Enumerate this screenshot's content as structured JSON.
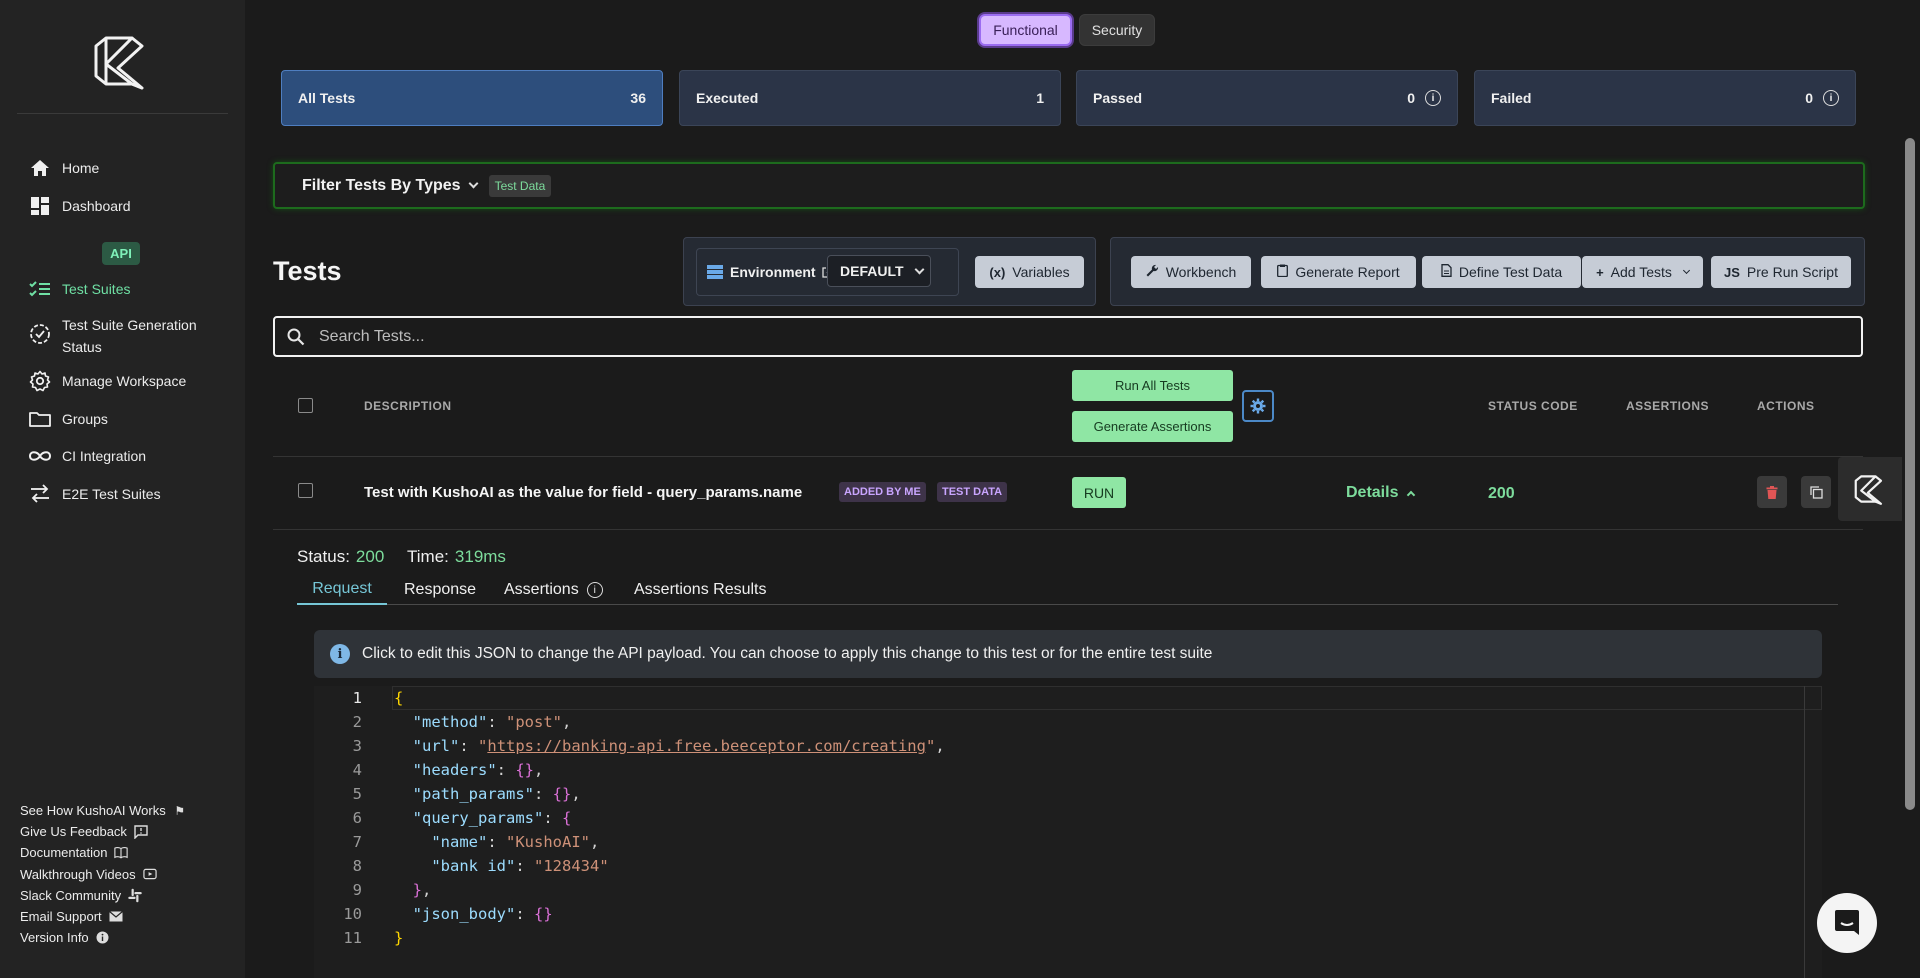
{
  "sidebar": {
    "nav": [
      {
        "label": "Home",
        "icon": "home-icon"
      },
      {
        "label": "Dashboard",
        "icon": "dashboard-icon"
      },
      {
        "label": "Test Suites",
        "icon": "test-suites-icon"
      },
      {
        "label": "Test Suite Generation Status",
        "icon": "generation-status-icon"
      },
      {
        "label": "Manage Workspace",
        "icon": "gear-icon"
      },
      {
        "label": "Groups",
        "icon": "folder-icon"
      },
      {
        "label": "CI Integration",
        "icon": "infinity-icon"
      },
      {
        "label": "E2E Test Suites",
        "icon": "e2e-icon"
      }
    ],
    "section_badge": "API",
    "footer": [
      {
        "label": "See How KushoAI Works",
        "icon": "flag-icon"
      },
      {
        "label": "Give Us Feedback",
        "icon": "feedback-icon"
      },
      {
        "label": "Documentation",
        "icon": "book-icon"
      },
      {
        "label": "Walkthrough Videos",
        "icon": "video-icon"
      },
      {
        "label": "Slack Community",
        "icon": "slack-icon"
      },
      {
        "label": "Email Support",
        "icon": "mail-icon"
      },
      {
        "label": "Version Info",
        "icon": "info-icon"
      }
    ]
  },
  "mode_toggle": {
    "functional": "Functional",
    "security": "Security",
    "selected": "Functional"
  },
  "stats": [
    {
      "label": "All Tests",
      "value": "36"
    },
    {
      "label": "Executed",
      "value": "1"
    },
    {
      "label": "Passed",
      "value": "0"
    },
    {
      "label": "Failed",
      "value": "0"
    }
  ],
  "filter": {
    "label": "Filter Tests By Types",
    "tag": "Test Data"
  },
  "tests_title": "Tests",
  "environment": {
    "label": "Environment",
    "selected": "DEFAULT",
    "variables_label": "Variables"
  },
  "actions": {
    "workbench": "Workbench",
    "generate_report": "Generate Report",
    "define_test_data": "Define Test Data",
    "add_tests": "Add Tests",
    "pre_run_script": "Pre Run Script",
    "pre_run_badge": "JS"
  },
  "search": {
    "placeholder": "Search Tests..."
  },
  "table": {
    "headers": {
      "description": "DESCRIPTION",
      "status_code": "STATUS CODE",
      "assertions": "ASSERTIONS",
      "actions": "ACTIONS"
    },
    "run_all": "Run All Tests",
    "generate_assertions": "Generate Assertions",
    "row": {
      "title": "Test with KushoAI as the value for field - query_params.name",
      "badge_added": "ADDED BY ME",
      "badge_testdata": "TEST DATA",
      "run_label": "RUN",
      "details_label": "Details",
      "status_code": "200"
    }
  },
  "result": {
    "status_label": "Status:",
    "status_value": "200",
    "time_label": "Time:",
    "time_value": "319ms",
    "tabs": [
      "Request",
      "Response",
      "Assertions",
      "Assertions Results"
    ],
    "active_tab": "Request",
    "info_text": "Click to edit this JSON to change the API payload. You can choose to apply this change to this test or for the entire test suite"
  },
  "request_json": {
    "method": "post",
    "url": "https://banking-api.free.beeceptor.com/creating",
    "query_name": "KushoAI",
    "query_bank_id": "128434",
    "line_numbers": [
      "1",
      "2",
      "3",
      "4",
      "5",
      "6",
      "7",
      "8",
      "9",
      "10",
      "11"
    ]
  },
  "colors": {
    "accent_green": "#7ddc9c",
    "functional_purple": "#d7b8ff",
    "all_tests_blue": "#2d4e7c"
  }
}
